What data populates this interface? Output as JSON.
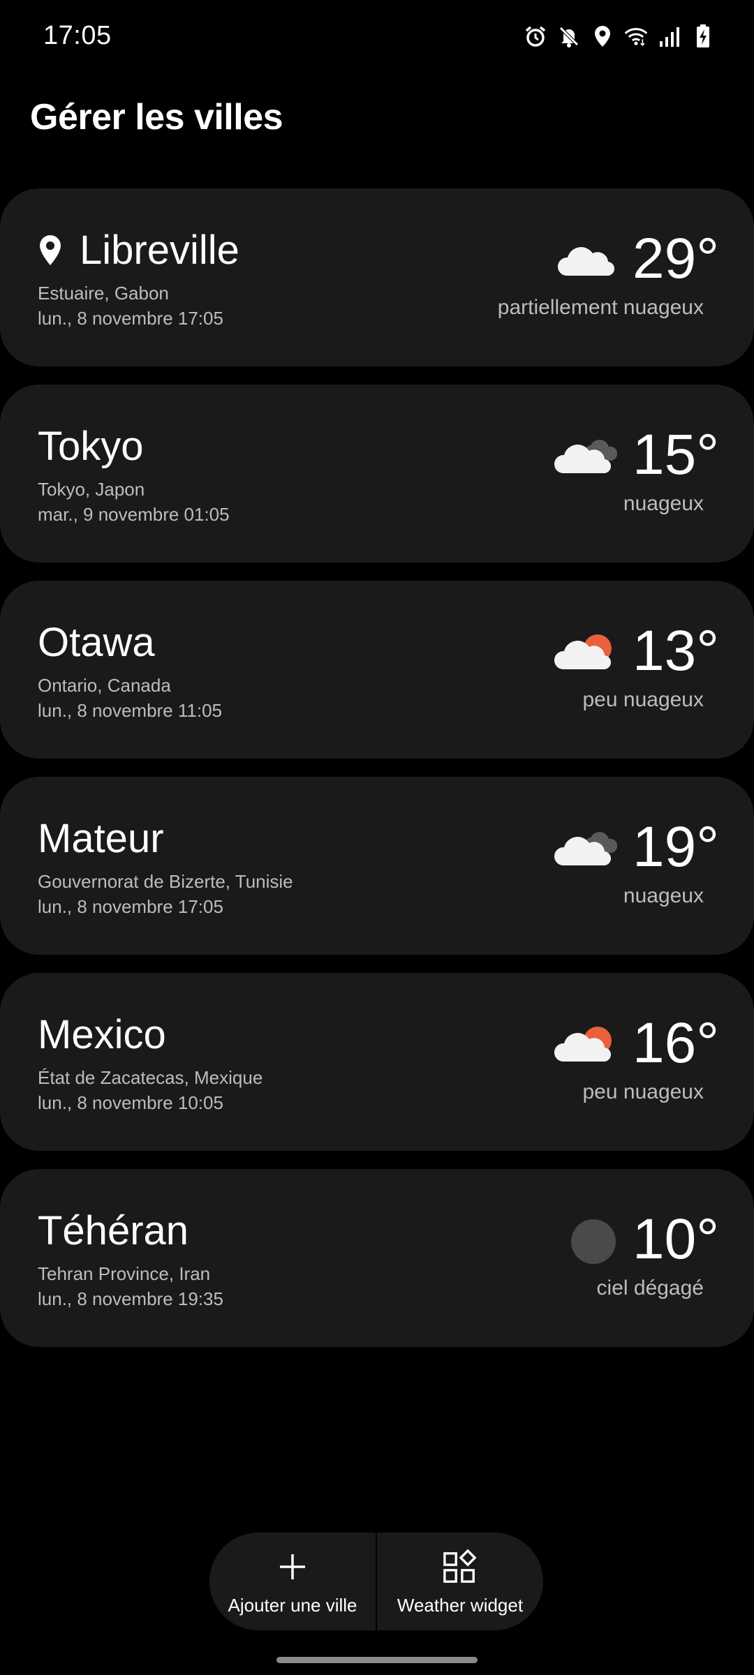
{
  "status_bar": {
    "time": "17:05",
    "icons": [
      "alarm-icon",
      "mute-icon",
      "location-icon",
      "wifi-icon",
      "signal-icon",
      "battery-charging-icon"
    ]
  },
  "header": {
    "title": "Gérer les villes"
  },
  "cities": [
    {
      "name": "Libreville",
      "is_current_location": true,
      "region": "Estuaire, Gabon",
      "datetime": "lun., 8 novembre 17:05",
      "temperature": "29°",
      "condition": "partiellement nuageux",
      "weather_icon": "partly-cloudy-icon"
    },
    {
      "name": "Tokyo",
      "is_current_location": false,
      "region": "Tokyo, Japon",
      "datetime": "mar., 9 novembre 01:05",
      "temperature": "15°",
      "condition": "nuageux",
      "weather_icon": "cloudy-icon"
    },
    {
      "name": "Otawa",
      "is_current_location": false,
      "region": "Ontario, Canada",
      "datetime": "lun., 8 novembre 11:05",
      "temperature": "13°",
      "condition": "peu nuageux",
      "weather_icon": "sun-behind-cloud-icon"
    },
    {
      "name": "Mateur",
      "is_current_location": false,
      "region": "Gouvernorat de Bizerte, Tunisie",
      "datetime": "lun., 8 novembre 17:05",
      "temperature": "19°",
      "condition": "nuageux",
      "weather_icon": "cloudy-icon"
    },
    {
      "name": "Mexico",
      "is_current_location": false,
      "region": "État de Zacatecas, Mexique",
      "datetime": "lun., 8 novembre 10:05",
      "temperature": "16°",
      "condition": "peu nuageux",
      "weather_icon": "sun-behind-cloud-icon"
    },
    {
      "name": "Téhéran",
      "is_current_location": false,
      "region": "Tehran Province, Iran",
      "datetime": "lun., 8 novembre 19:35",
      "temperature": "10°",
      "condition": "ciel dégagé",
      "weather_icon": "clear-night-moon-icon"
    }
  ],
  "actions": {
    "add_city_label": "Ajouter une ville",
    "weather_widget_label": "Weather widget"
  },
  "colors": {
    "background": "#000000",
    "card": "#1a1a1a",
    "text_primary": "#ffffff",
    "text_secondary": "#bdbdbd",
    "sun_accent": "#e8603c",
    "cloud": "#f2f2f2",
    "cloud_dark": "#5a5a5a",
    "moon": "#4a4a4a"
  }
}
